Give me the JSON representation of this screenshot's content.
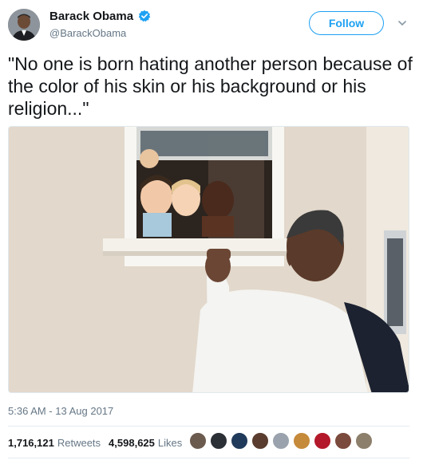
{
  "author": {
    "name": "Barack Obama",
    "handle": "@BarackObama",
    "verified": true,
    "avatar_icon": "profile-photo"
  },
  "actions": {
    "follow_label": "Follow",
    "menu_icon": "chevron-down-icon"
  },
  "tweet": {
    "text": "\"No one is born hating another person because of the color of his skin or his background or his religion...\"",
    "photo_icon": "photo-man-children-window"
  },
  "meta": {
    "timestamp": "5:36 AM - 13 Aug 2017"
  },
  "stats": {
    "retweets_count": "1,716,121",
    "retweets_label": "Retweets",
    "likes_count": "4,598,625",
    "likes_label": "Likes"
  },
  "likers": [
    {
      "color": "#6b5a4e"
    },
    {
      "color": "#2b2f36"
    },
    {
      "color": "#1f3a5a"
    },
    {
      "color": "#5a3d2e"
    },
    {
      "color": "#9aa3ad"
    },
    {
      "color": "#c58a3a"
    },
    {
      "color": "#b3192a"
    },
    {
      "color": "#7a4a3c"
    },
    {
      "color": "#8c7f6b"
    }
  ],
  "colors": {
    "accent": "#1da1f2",
    "secondary_text": "#657786",
    "divider": "#e6ecf0"
  }
}
